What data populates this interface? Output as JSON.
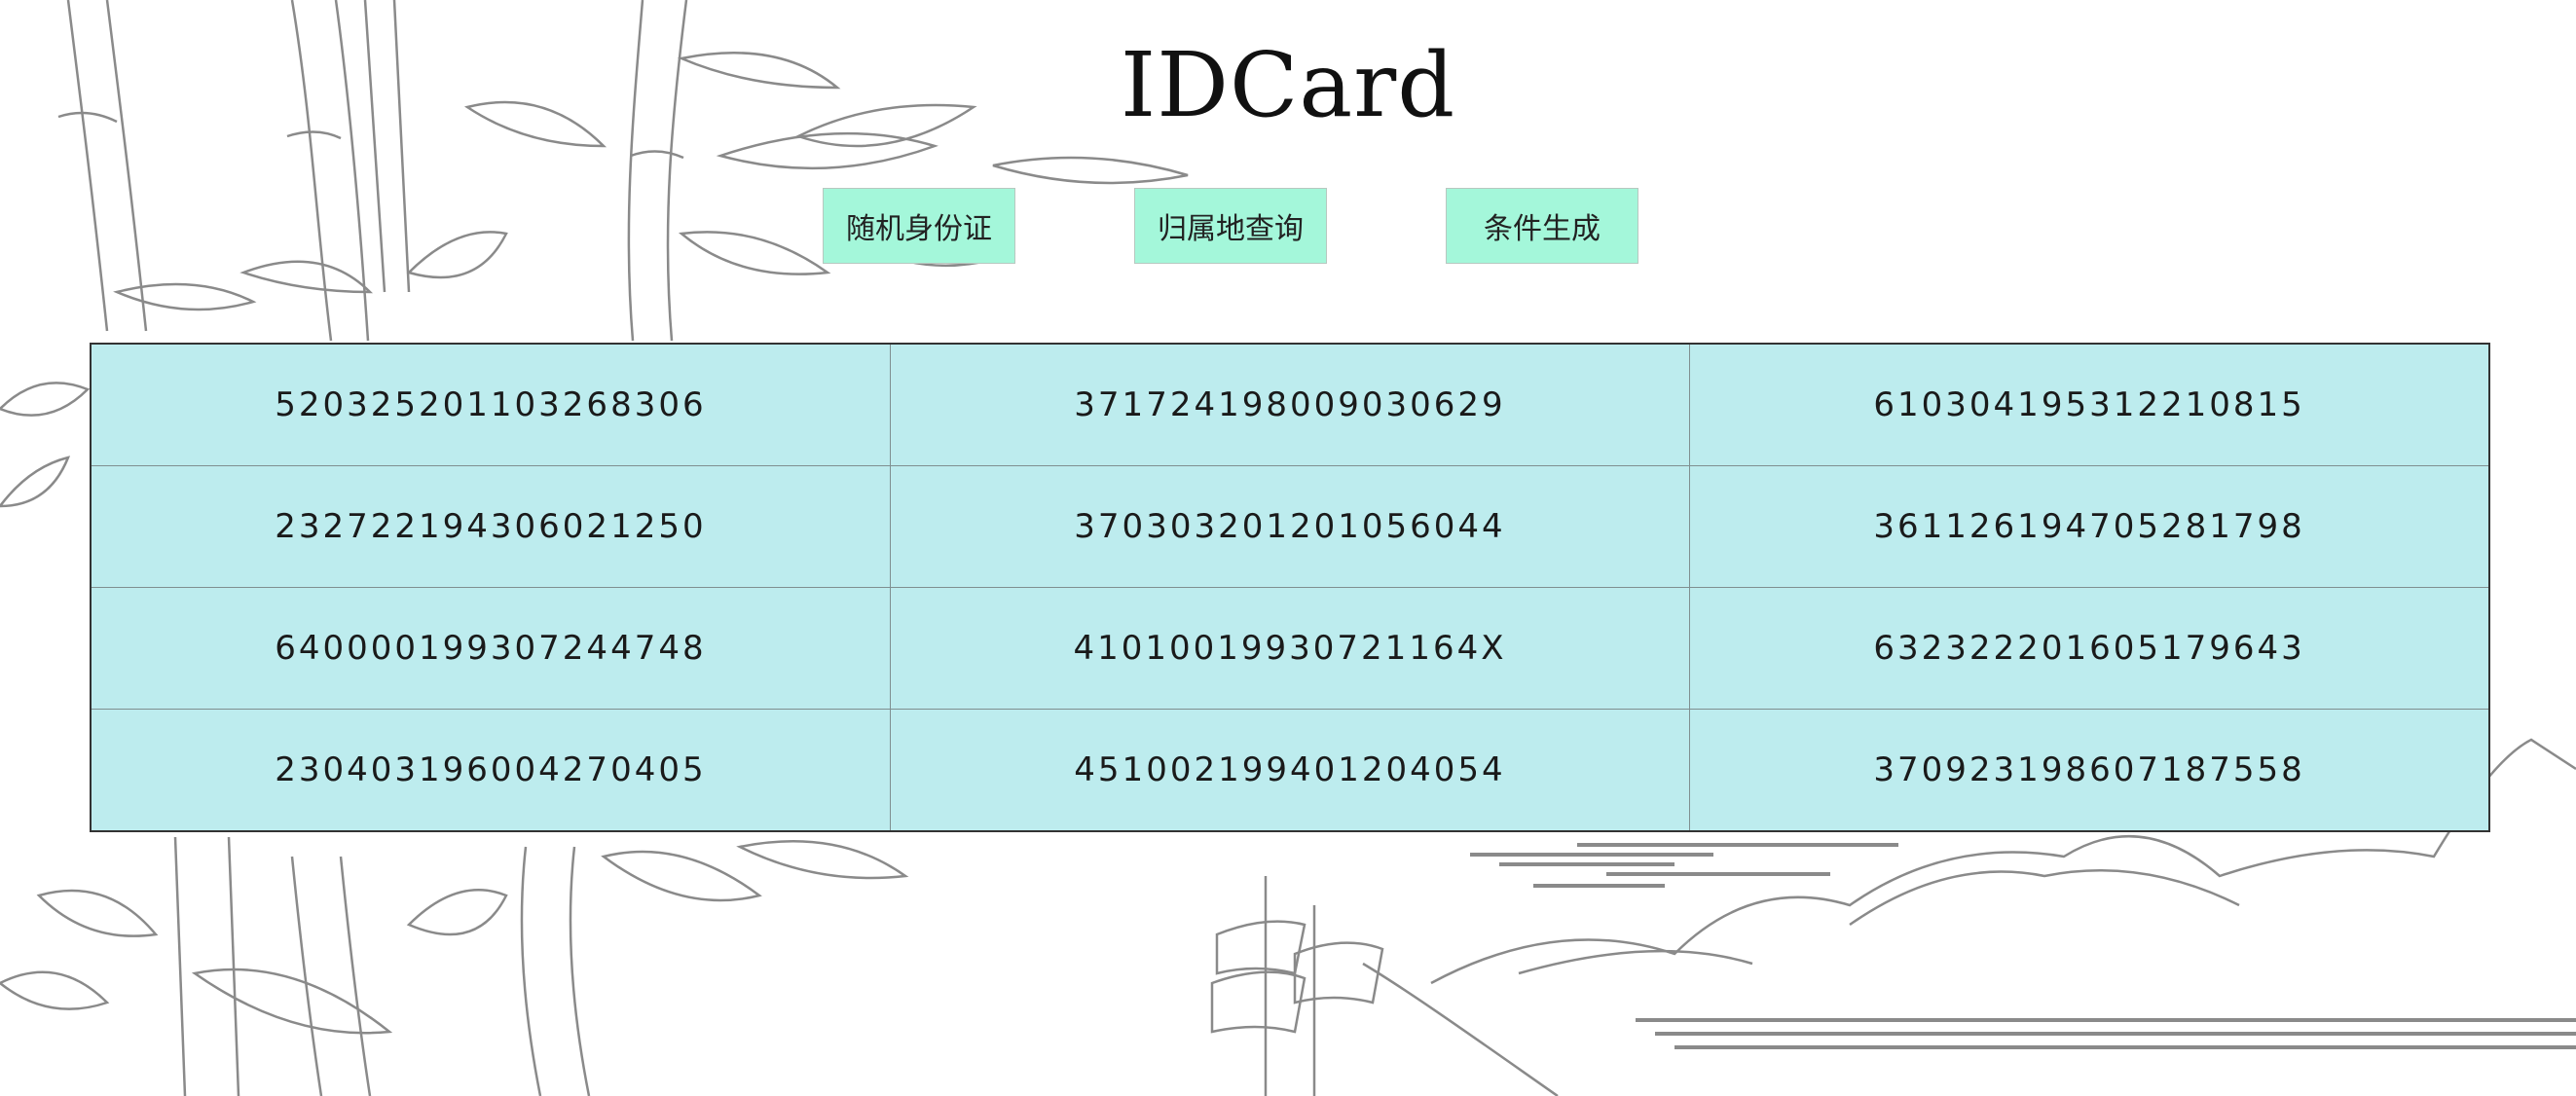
{
  "app": {
    "title": "IDCard"
  },
  "toolbar": {
    "random_label": "随机身份证",
    "region_label": "归属地查询",
    "conditional_label": "条件生成"
  },
  "table": {
    "rows": [
      [
        "520325201103268306",
        "371724198009030629",
        "610304195312210815"
      ],
      [
        "232722194306021250",
        "370303201201056044",
        "361126194705281798"
      ],
      [
        "640000199307244748",
        "41010019930721164X",
        "632322201605179643"
      ],
      [
        "230403196004270405",
        "451002199401204054",
        "370923198607187558"
      ]
    ]
  },
  "colors": {
    "button_bg": "#a4f7da",
    "table_bg": "#bdecee",
    "line_art": "#8a8a8a"
  }
}
